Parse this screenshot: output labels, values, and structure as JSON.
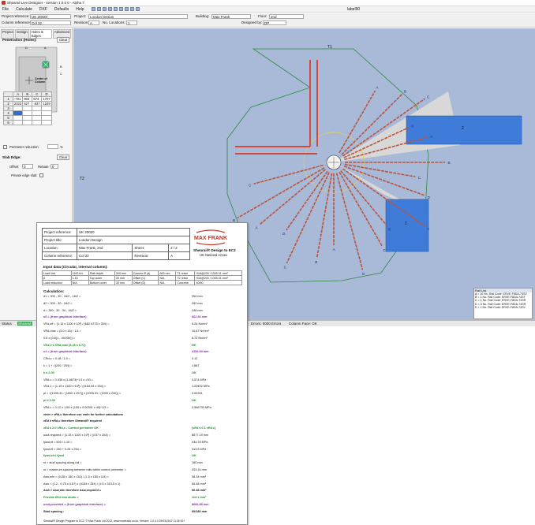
{
  "app": {
    "title": "Shearail Live Designer - version 1.0.0.0 - Alpha 7",
    "label_right": "label90"
  },
  "menu": [
    "File",
    "Calculate",
    "DXF",
    "Defaults",
    "Help"
  ],
  "fields": {
    "project_reference_label": "Project reference:",
    "project_reference": "UK 20020",
    "project_label": "Project:",
    "project": "London Design",
    "building_label": "Building:",
    "building": "Max Frank",
    "floor_label": "Floor:",
    "floor": "2nd",
    "column_reference_label": "Column reference:",
    "column_reference": "Col 32",
    "revision_label": "Revision:",
    "revision": "A",
    "no_locations_label": "No. Locations:",
    "no_locations": "1",
    "designed_by_label": "Designed by:",
    "designed_by": "DP"
  },
  "left_panel": {
    "tabs": [
      "Project",
      "Design",
      "Holes & Edges",
      "Advanced"
    ],
    "penetration_title": "Penetration (Holes):",
    "clear_label": "Clear",
    "diagram_label": "Centre of Column",
    "diagram_letters": [
      "D",
      "A",
      "B",
      "C"
    ],
    "table_headers": [
      "",
      "A",
      "B",
      "C",
      "D"
    ],
    "rows": [
      {
        "id": "1",
        "values": [
          "-701",
          "903",
          "674",
          "1707"
        ]
      },
      {
        "id": "2",
        "values": [
          "2023",
          "527",
          "-637",
          "1349"
        ]
      },
      {
        "id": "3",
        "values": [
          "",
          "",
          "",
          ""
        ]
      },
      {
        "id": "4",
        "values": [
          "",
          "",
          "",
          ""
        ]
      },
      {
        "id": "5",
        "values": [
          "",
          "",
          "",
          ""
        ]
      },
      {
        "id": "6",
        "values": [
          "",
          "",
          "",
          ""
        ]
      }
    ],
    "perimeter_reduction_label": "Perimeter reduction:",
    "perimeter_unit": "%",
    "slab_edge_title": "Slab Edge:",
    "offset_label": "Offset:",
    "offset_value": "0",
    "rebate_label": "Rebate:",
    "rebate_value": "0",
    "private_edge_label": "Private edge slab:"
  },
  "canvas": {
    "hole_labels": [
      "2",
      "1"
    ],
    "dim_labels": [
      "T1",
      "T2"
    ],
    "rail_letters": [
      "A",
      "B",
      "C",
      "D"
    ]
  },
  "rail_list": {
    "title": "Rail List",
    "items": [
      "A = 10 No. Rail Code: ERVE-F8DA-74SV",
      "B = 1 No. Rail Code: ERVE-F8DA-74ST",
      "C = 1 No. Rail Code: ERVE-F8DA-74SR",
      "D = 5 No. Rail Code: ERVE-F8DA-74SR",
      "E = 2 No. Rail Code: ERVE-F8DA-74SV"
    ]
  },
  "status": {
    "status_label": "Status",
    "status_value": "Shearail",
    "result": "Errors: 0000 Errors",
    "column_face": "Column Face: OK"
  },
  "report": {
    "header_rows": [
      {
        "label": "Project reference:",
        "value": "UK 20020"
      },
      {
        "label": "Project title:",
        "value": "London Design"
      },
      {
        "label": "Location:",
        "value": "Max Frank, 2nd",
        "extra_label": "Sheet:",
        "extra_value": "2 / 2"
      },
      {
        "label": "Column reference:",
        "value": "Col 32",
        "extra_label": "Revision:",
        "extra_value": "A"
      }
    ],
    "brand": "MAX FRANK",
    "brand_sub": "Shearail® Design to EC2",
    "brand_sub2": "UK National Annex",
    "input_title": "Input data (Circular, internal column):",
    "input_rows": [
      [
        "Load Ved",
        "1100 kN",
        "Slab depth",
        "300 mm",
        "Column Ø (d)",
        "600 mm",
        "T1 rebar",
        "H16@200 / 1005.31 mm²"
      ],
      [
        "β",
        "1.15",
        "Top cover",
        "30 mm",
        "Offset (C)",
        "N/A",
        "T2 rebar",
        "H16@200 / 1005.31 mm²"
      ],
      [
        "Load reduction",
        "N/A",
        "Bottom cover",
        "30 mm",
        "Offset (D)",
        "N/A",
        "Concrete",
        "40/50"
      ]
    ],
    "calc_title": "Calculation:",
    "calc_lines": [
      {
        "t": "d1 =       300 - 30 - 16/2 - 16/2 =",
        "r": "254 mm",
        "c": ""
      },
      {
        "t": "d2 =       300 - 30 - 16/2 =",
        "r": "262 mm",
        "c": ""
      },
      {
        "t": "d =        300 - 30 - 30 - 16/2 =",
        "r": "248 mm",
        "c": ""
      },
      {
        "t": "u0 =   (from graphical interface)",
        "r": "662.46 mm",
        "c": "purple"
      },
      {
        "t": "VEd,eff =   (1.15 x 1100 x 10³) / (662.4775 x 254) =",
        "r": "5.26 N/mm²",
        "c": ""
      },
      {
        "t": "VRd,max =   (3.0 x 40) / 1.5 =",
        "r": "10.67 N/mm²",
        "c": ""
      },
      {
        "t": "               0.5 x (0.6(1 - 40/250)) =",
        "r": "6.72 N/mm²",
        "c": ""
      },
      {
        "t": "               VEd,0 ≤ VRd,max   (5.26 ≤ 6.72)",
        "r": "OK",
        "c": "green"
      },
      {
        "t": "u1 =   (from graphical interface)",
        "r": "4154.54 mm",
        "c": "purple"
      },
      {
        "t": "CRd,c =   0.18 / 1.5 =",
        "r": "0.12",
        "c": ""
      },
      {
        "t": "k =       1 + √(200 / 254) =",
        "r": "1.887",
        "c": ""
      },
      {
        "t": "               k ≤ 2.00",
        "r": "OK",
        "c": "green"
      },
      {
        "t": "VRd,c =   0.035 x (1.8873)^1.5 x √40 =",
        "r": "0.574 MPa",
        "c": ""
      },
      {
        "t": "VEd,1 =   (1.15 x 1100 x 10³) / (4154.54 x 254) =",
        "r": "1.20402 MPa",
        "c": ""
      },
      {
        "t": "ρl =       √(1005.31 / (1000 x 257)) x (1005.31 / (1000 x 240)) =",
        "r": "0.00391",
        "c": ""
      },
      {
        "t": "               ρl ≤ 0.02",
        "r": "OK",
        "c": "green"
      },
      {
        "t": "VRd,c =   0.12 x 1.89 x (100 x 0.00391 x 40)^1/3 =",
        "r": "0.566730 MPa",
        "c": ""
      },
      {
        "t": "               vmin > vRd,c therefore use vmin for further calculations",
        "r": "",
        "c": "bold"
      },
      {
        "t": "               vEd ≥ vRd,c therefore Shearail® required",
        "r": "",
        "c": "bold"
      },
      {
        "t": "               vEd ≤ 2.0 vRd,c   - Control perimeter OK",
        "r": "(vEd ≤ 0.1 vRd,c)",
        "c": "green"
      },
      {
        "t": "uout,required =   (1.15 x 1100 x 10³) / (0.57 x 254) =",
        "r": "8677.19 mm",
        "c": ""
      },
      {
        "t": "fywd,ef =   500 / 1.15 =",
        "r": "434.78 MPa",
        "c": ""
      },
      {
        "t": "fywd,ef =   250 + 0.25 x 254 =",
        "r": "313.5 MPa",
        "c": ""
      },
      {
        "t": "               fywd,ef ≤ fywd",
        "r": "OK",
        "c": "green"
      },
      {
        "t": "sr =       stud spacing along rail =",
        "r": "180 mm",
        "c": ""
      },
      {
        "t": "st =       maximum spacing between rails within control perimeter =",
        "r": "203.15 mm",
        "c": ""
      },
      {
        "t": "Asw,min =  (0.08 x 180 x √40) / (1.5 x 180 x 0.8) =",
        "r": "38.34 mm²",
        "c": ""
      },
      {
        "t": "Asw =      (1.2 - 0.75 x 0.57) x (4154 x 254) / (1.5 x 313.5 x 1)",
        "r": "60.48 mm²",
        "c": ""
      },
      {
        "t": "               Asw > Asw,min therefore Asw,required =",
        "r": "60.48 mm²",
        "c": "bold"
      },
      {
        "t": "               Provide Ø12 mm studs =",
        "r": "113.1 mm²",
        "c": "green"
      },
      {
        "t": "uout,provided =   (from graphical interface) =",
        "r": "8684.85 mm",
        "c": "purple"
      },
      {
        "t": "               Stud spacing :",
        "r": "60/180 mm",
        "c": "bold"
      }
    ],
    "footer": "Shearail® Design Program to EC2, © Max Frank Ltd 2012, www.maxfrank.co.uk, Version: 1.0.0.0   29/03/2022 11:35:32+"
  }
}
